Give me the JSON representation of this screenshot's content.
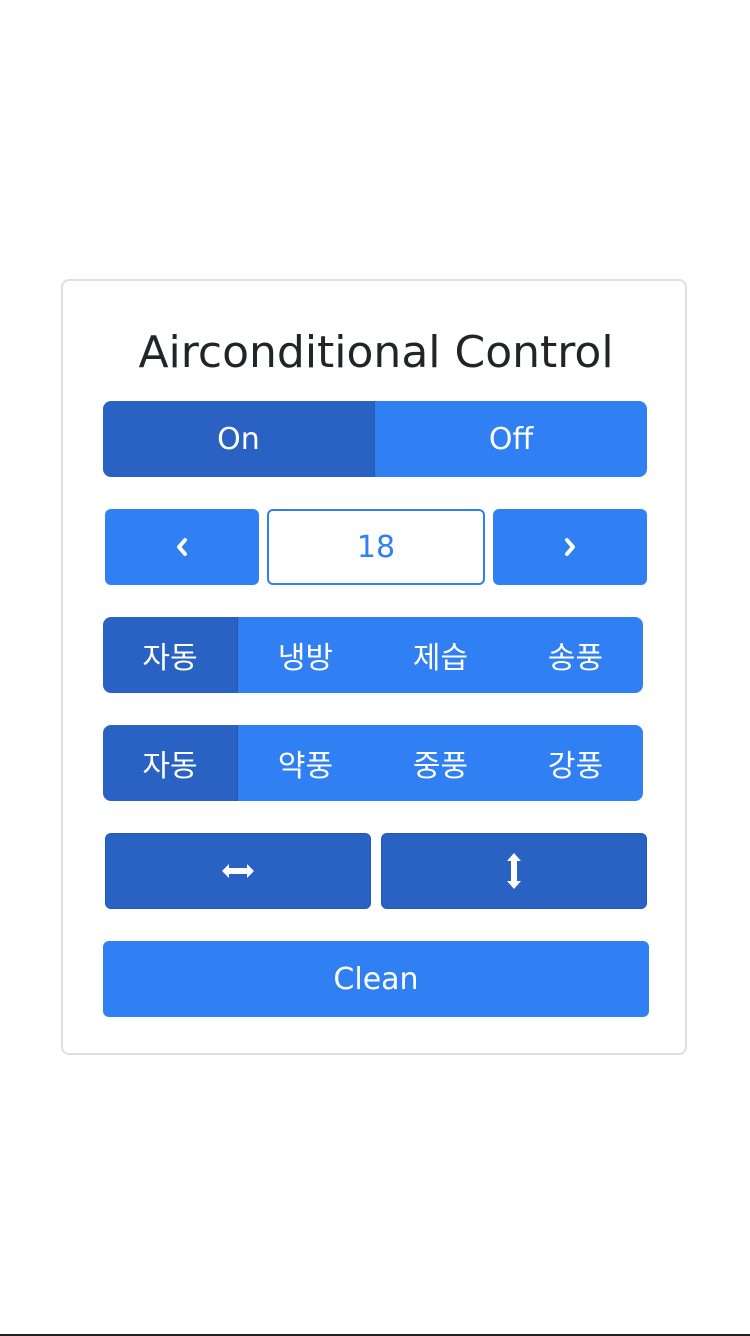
{
  "title": "Airconditional Control",
  "power": {
    "on_label": "On",
    "off_label": "Off",
    "active": "On"
  },
  "temperature": {
    "value": "18",
    "decrease_icon": "chevron-left-icon",
    "increase_icon": "chevron-right-icon"
  },
  "mode": {
    "options": [
      "자동",
      "냉방",
      "제습",
      "송풍"
    ],
    "active": "자동"
  },
  "fan_speed": {
    "options": [
      "자동",
      "약풍",
      "중풍",
      "강풍"
    ],
    "active": "자동"
  },
  "swing": {
    "horizontal_icon": "arrows-horizontal-icon",
    "vertical_icon": "arrows-vertical-icon"
  },
  "clean": {
    "label": "Clean"
  },
  "colors": {
    "primary": "#3080f3",
    "primary_active": "#2a62c4",
    "title_text": "#212529",
    "card_border": "#dfdfdf"
  }
}
